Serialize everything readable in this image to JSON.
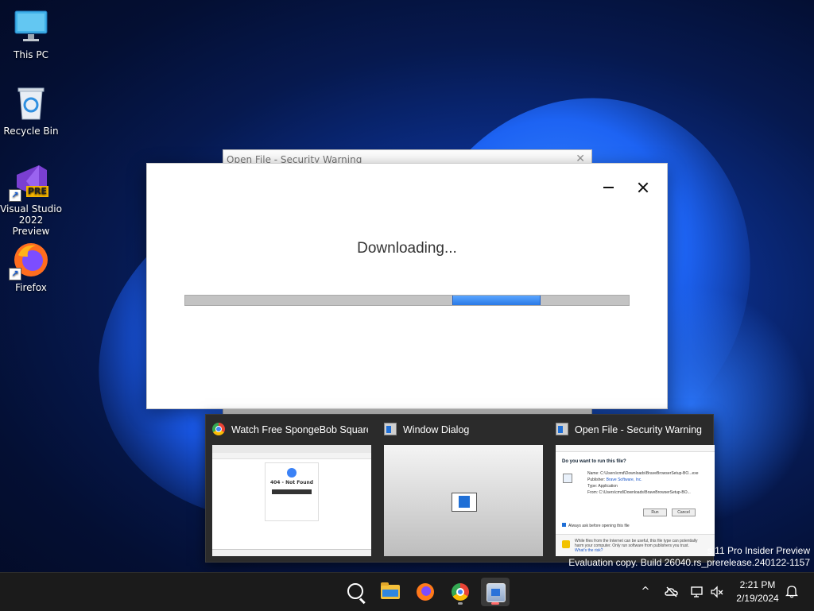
{
  "desktop": {
    "icons": [
      {
        "label": "This PC",
        "icon": "monitor-icon"
      },
      {
        "label": "Recycle Bin",
        "icon": "recycle-bin-icon"
      },
      {
        "label": "Visual Studio 2022 Preview",
        "icon": "visual-studio-icon",
        "badge": "PRE"
      },
      {
        "label": "Firefox",
        "icon": "firefox-icon"
      }
    ],
    "watermark": {
      "line1": "s 11 Pro Insider Preview",
      "line2": "Evaluation copy. Build 26040.rs_prerelease.240122-1157"
    }
  },
  "back_dialog": {
    "title": "Open File - Security Warning"
  },
  "download_window": {
    "title": "Downloading...",
    "progress": {
      "start_fraction": 0.603,
      "end_fraction": 0.801
    },
    "accent": "#2a79e6"
  },
  "thumbnails": [
    {
      "title": "Watch Free SpongeBob Square...",
      "icon": "chrome-icon",
      "preview": {
        "heading": "404 - Not Found"
      }
    },
    {
      "title": "Window Dialog",
      "icon": "window-icon"
    },
    {
      "title": "Open File - Security Warning",
      "icon": "window-icon",
      "preview": {
        "question": "Do you want to run this file?",
        "name_label": "Name:",
        "name_value": "C:\\Users\\cmd\\Downloads\\BraveBrowserSetup-BO...exe",
        "publisher_label": "Publisher:",
        "publisher_value": "Brave Software, Inc.",
        "type_label": "Type:",
        "type_value": "Application",
        "from_label": "From:",
        "from_value": "C:\\Users\\cmd\\Downloads\\BraveBrowserSetup-BO...",
        "run_label": "Run",
        "cancel_label": "Cancel",
        "checkbox_label": "Always ask before opening this file",
        "warning_text": "While files from the Internet can be useful, this file type can potentially harm your computer. Only run software from publishers you trust.",
        "link_text": "What's the risk?"
      }
    }
  ],
  "taskbar": {
    "apps": [
      {
        "name": "search",
        "icon": "search-icon"
      },
      {
        "name": "file-explorer",
        "icon": "folder-icon"
      },
      {
        "name": "firefox",
        "icon": "firefox-icon"
      },
      {
        "name": "chrome",
        "icon": "chrome-icon"
      },
      {
        "name": "setup",
        "icon": "setup-icon",
        "active": true
      }
    ],
    "tray": {
      "chevron": "^",
      "time": "2:21 PM",
      "date": "2/19/2024"
    }
  }
}
